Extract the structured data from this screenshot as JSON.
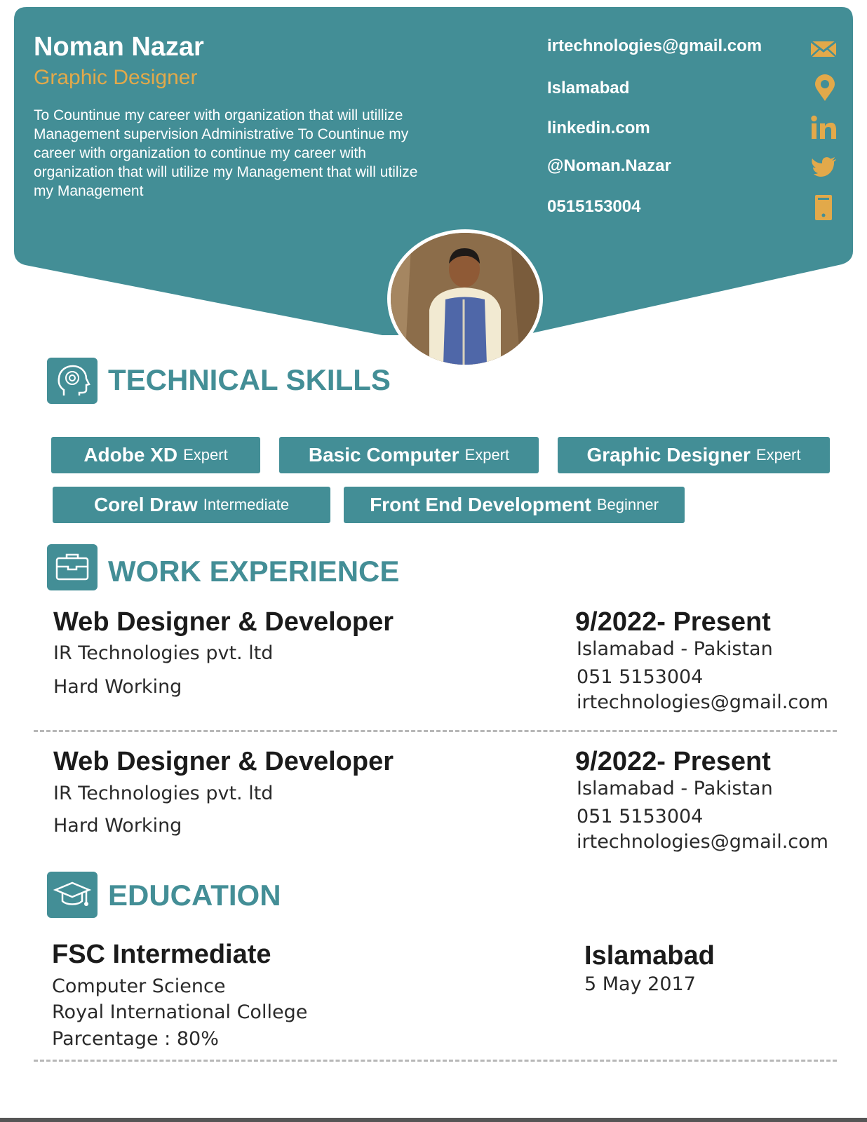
{
  "profile": {
    "name": "Noman Nazar",
    "role": "Graphic Designer",
    "summary": "To Countinue my career with organization that will utillize Management supervision Administrative To Countinue my career with organization to continue my career with organization that will utilize my Management that will utilize my Management"
  },
  "contacts": [
    {
      "text": "irtechnologies@gmail.com",
      "icon": "envelope-icon"
    },
    {
      "text": "Islamabad",
      "icon": "location-pin-icon"
    },
    {
      "text": "linkedin.com",
      "icon": "linkedin-icon"
    },
    {
      "text": "@Noman.Nazar",
      "icon": "twitter-icon"
    },
    {
      "text": "0515153004",
      "icon": "phone-icon"
    }
  ],
  "colors": {
    "accent": "#438e96",
    "highlight": "#e2a94a"
  },
  "skills_section": {
    "title": "TECHNICAL SKILLS",
    "items": [
      {
        "name": "Adobe XD",
        "level": "Expert"
      },
      {
        "name": "Basic Computer",
        "level": "Expert"
      },
      {
        "name": "Graphic Designer",
        "level": "Expert"
      },
      {
        "name": "Corel Draw",
        "level": "Intermediate"
      },
      {
        "name": "Front End Development",
        "level": "Beginner"
      }
    ]
  },
  "work_section": {
    "title": "WORK EXPERIENCE",
    "jobs": [
      {
        "title": "Web Designer & Developer",
        "company": "IR Technologies pvt. ltd",
        "note": "Hard Working",
        "date": "9/2022- Present",
        "location": "Islamabad - Pakistan",
        "phone": "051 5153004",
        "email": "irtechnologies@gmail.com"
      },
      {
        "title": "Web Designer & Developer",
        "company": "IR Technologies pvt. ltd",
        "note": "Hard Working",
        "date": "9/2022- Present",
        "location": "Islamabad - Pakistan",
        "phone": "051 5153004",
        "email": "irtechnologies@gmail.com"
      }
    ]
  },
  "education_section": {
    "title": "EDUCATION",
    "entries": [
      {
        "degree": "FSC Intermediate",
        "field": "Computer Science",
        "school": "Royal International College",
        "grade": "Parcentage : 80%",
        "place": "Islamabad",
        "date": "5 May 2017"
      }
    ]
  }
}
